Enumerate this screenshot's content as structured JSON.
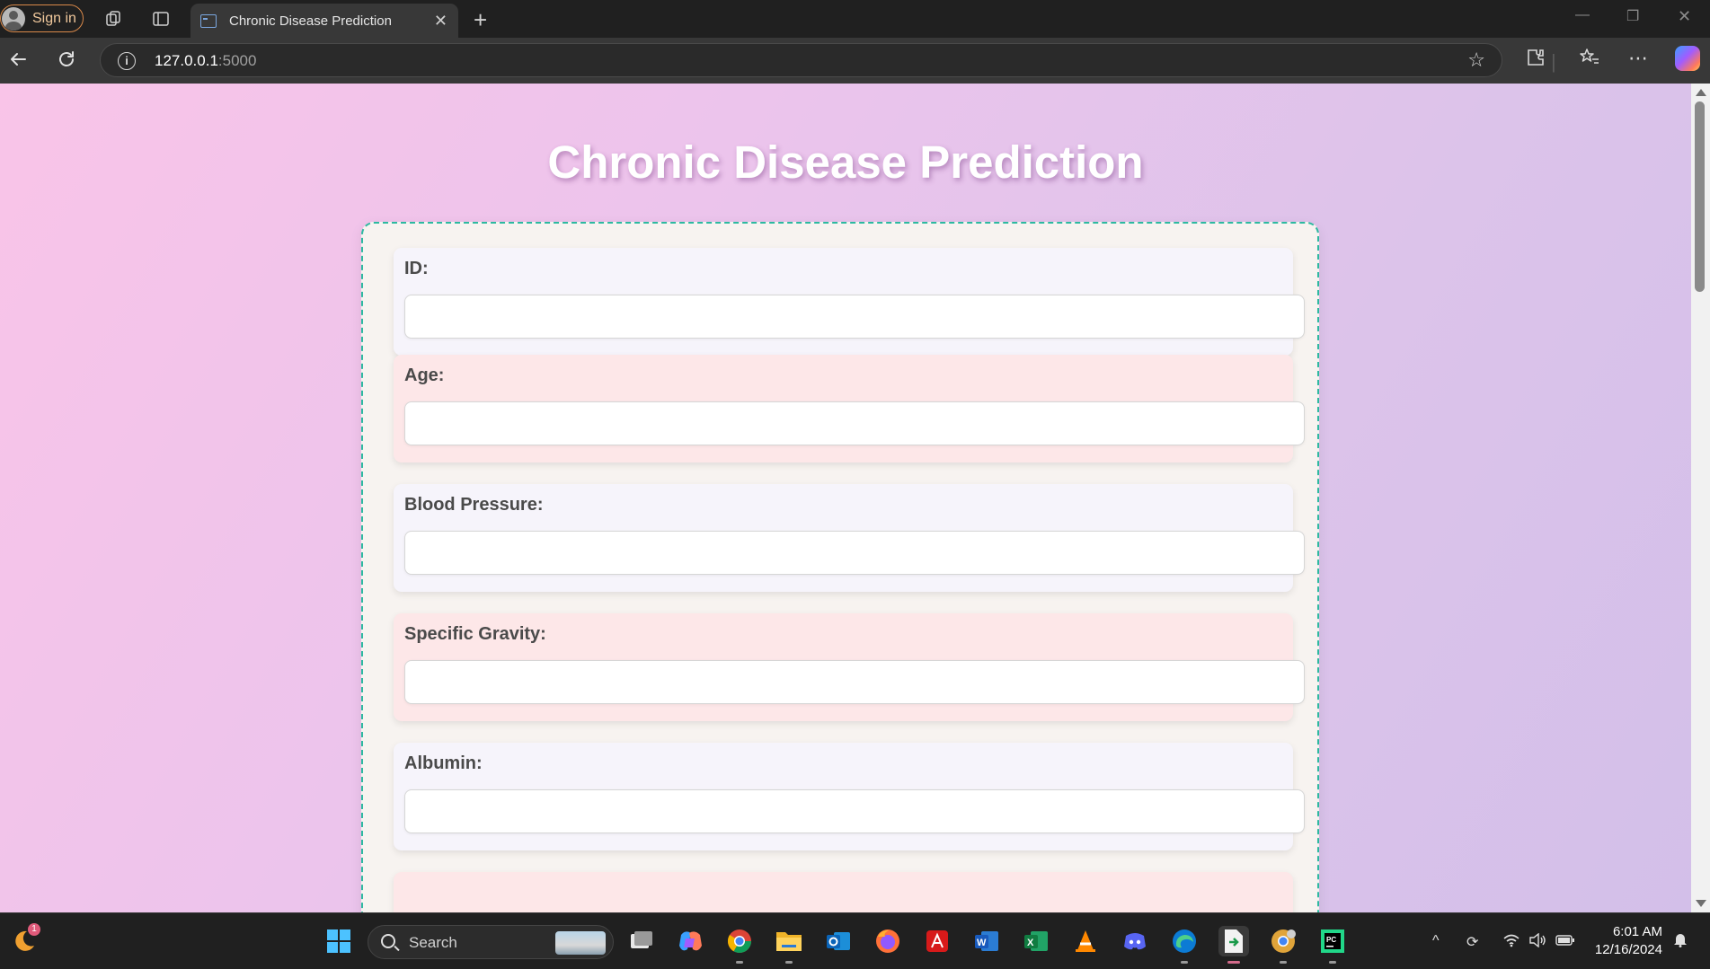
{
  "browser": {
    "sign_in_label": "Sign in",
    "tab_title": "Chronic Disease Prediction",
    "url_host": "127.0.0.1",
    "url_port": ":5000"
  },
  "page": {
    "title": "Chronic Disease Prediction",
    "fields": [
      {
        "label": "ID:",
        "value": ""
      },
      {
        "label": "Age:",
        "value": ""
      },
      {
        "label": "Blood Pressure:",
        "value": ""
      },
      {
        "label": "Specific Gravity:",
        "value": ""
      },
      {
        "label": "Albumin:",
        "value": ""
      }
    ]
  },
  "taskbar": {
    "search_placeholder": "Search",
    "notification_count": "1",
    "time": "6:01 AM",
    "date": "12/16/2024",
    "apps": [
      "start-icon",
      "task-view-icon",
      "copilot-icon",
      "chrome-icon",
      "file-explorer-icon",
      "outlook-icon",
      "firefox-icon",
      "acrobat-icon",
      "word-icon",
      "excel-icon",
      "vlc-icon",
      "discord-icon",
      "edge-icon",
      "file-manager-icon",
      "chrome-canary-icon",
      "pycharm-icon"
    ]
  },
  "colors": {
    "form_border": "#2db9a0",
    "field_lavender": "#f6f4fb",
    "field_pink": "#fde7e8",
    "page_gradient_start": "#f9c4e8",
    "page_gradient_end": "#d3bfe9"
  }
}
